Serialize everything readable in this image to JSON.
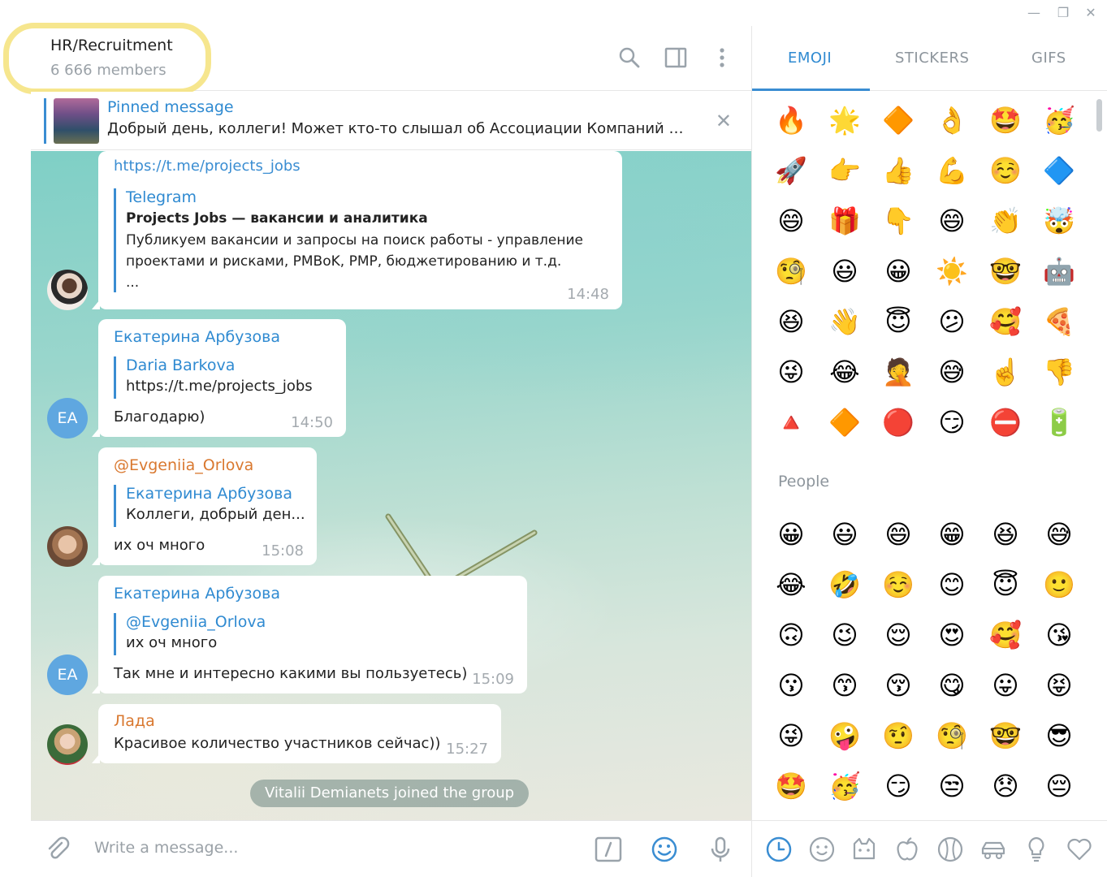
{
  "window": {
    "minimize_glyph": "—",
    "restore_glyph": "❐",
    "close_glyph": "✕"
  },
  "header": {
    "title": "HR/Recruitment",
    "subtitle": "6 666 members"
  },
  "pinned": {
    "title": "Pinned message",
    "text": "Добрый день, коллеги!  Может кто-то слышал об Ассоциации Компаний п..."
  },
  "messages": {
    "m1": {
      "link": "https://t.me/projects_jobs",
      "preview_site": "Telegram",
      "preview_title": "Projects Jobs — вакансии и аналитика",
      "preview_line1": "Публикуем вакансии и запросы на поиск работы - управление",
      "preview_line2": "проектами и рисками, PMBoK, PMP, бюджетированию и т.д.",
      "preview_line3": "...",
      "time": "14:48"
    },
    "m2": {
      "sender": "Екатерина Арбузова",
      "quote_name": "Daria Barkova",
      "quote_text": "https://t.me/projects_jobs",
      "text": "Благодарю)",
      "time": "14:50",
      "avatar": "EA"
    },
    "m3": {
      "sender": "@Evgeniia_Orlova",
      "quote_name": "Екатерина Арбузова",
      "quote_text": "Коллеги, добрый ден...",
      "text": "их оч много",
      "time": "15:08"
    },
    "m4": {
      "sender": "Екатерина Арбузова",
      "quote_name": "@Evgeniia_Orlova",
      "quote_text": "их оч много",
      "text": "Так мне и интересно какими вы пользуетесь)",
      "time": "15:09",
      "avatar": "EA"
    },
    "m5": {
      "sender": "Лада",
      "text": "Красивое количество участников сейчас))",
      "time": "15:27"
    },
    "service": "Vitalii Demianets joined the group"
  },
  "composer": {
    "placeholder": "Write a message..."
  },
  "panel": {
    "tabs": [
      "EMOJI",
      "STICKERS",
      "GIFS"
    ],
    "section_people": "People",
    "recent_emoji": [
      "🔥",
      "🌟",
      "🔶",
      "👌",
      "🤩",
      "🥳",
      "🚀",
      "👉",
      "👍",
      "💪",
      "☺️",
      "🔷",
      "😄",
      "🎁",
      "👇",
      "😄",
      "👏",
      "🤯",
      "🧐",
      "😃",
      "😀",
      "☀️",
      "🤓",
      "🤖",
      "😆",
      "👋",
      "😇",
      "😕",
      "🥰",
      "🍕",
      "😜",
      "😂",
      "🤦",
      "😅",
      "☝️",
      "👎",
      "🔺",
      "🔶",
      "🔴",
      "😏",
      "⛔",
      "🔋"
    ],
    "people_emoji": [
      "😀",
      "😃",
      "😄",
      "😁",
      "😆",
      "😅",
      "😂",
      "🤣",
      "☺️",
      "😊",
      "😇",
      "🙂",
      "🙃",
      "😉",
      "😌",
      "😍",
      "🥰",
      "😘",
      "😗",
      "😙",
      "😚",
      "😋",
      "😛",
      "😝",
      "😜",
      "🤪",
      "🤨",
      "🧐",
      "🤓",
      "😎",
      "🤩",
      "🥳",
      "😏",
      "😒",
      "😞",
      "😔"
    ]
  },
  "colors": {
    "accent": "#3a8dd2",
    "sender_blue": "#2f8ad1",
    "sender_orange": "#d9782f",
    "avatar_blue": "#5fa7e0",
    "highlight": "#f4e27a"
  }
}
